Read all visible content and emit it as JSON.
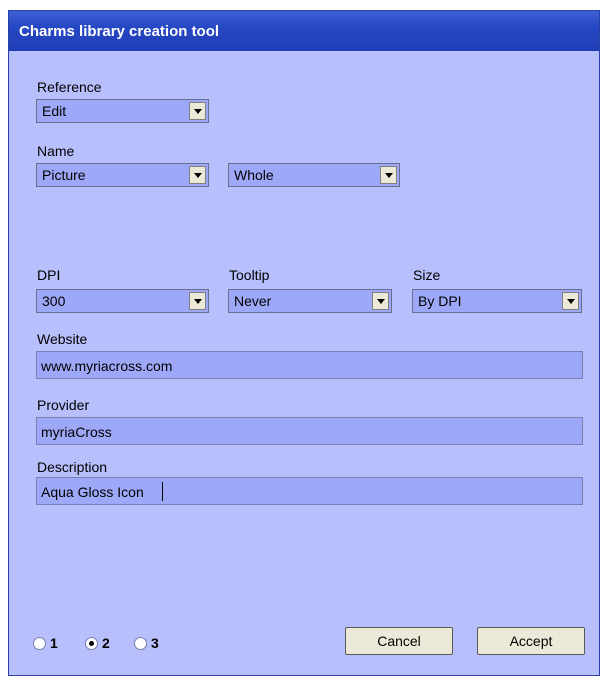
{
  "window": {
    "title": "Charms library creation tool"
  },
  "reference": {
    "label": "Reference",
    "value": "Edit"
  },
  "name": {
    "label": "Name",
    "value1": "Picture",
    "value2": "Whole"
  },
  "dpi": {
    "label": "DPI",
    "value": "300"
  },
  "tooltip": {
    "label": "Tooltip",
    "value": "Never"
  },
  "size": {
    "label": "Size",
    "value": "By DPI"
  },
  "website": {
    "label": "Website",
    "value": "www.myriacross.com"
  },
  "provider": {
    "label": "Provider",
    "value": "myriaCross"
  },
  "description": {
    "label": "Description",
    "value": "Aqua Gloss Icon"
  },
  "pages": {
    "options": [
      "1",
      "2",
      "3"
    ],
    "selected": "2"
  },
  "buttons": {
    "cancel": "Cancel",
    "accept": "Accept"
  }
}
